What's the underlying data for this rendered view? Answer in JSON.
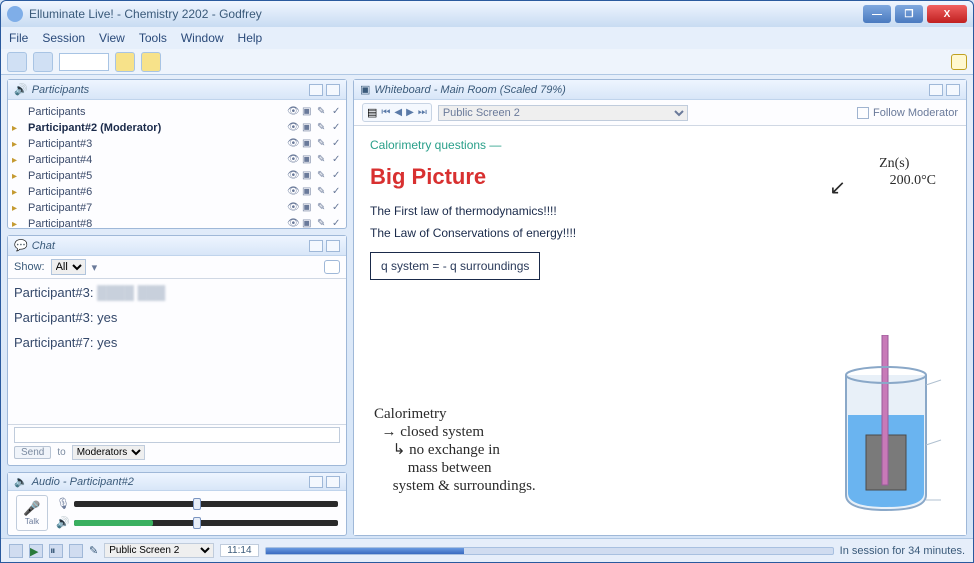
{
  "window": {
    "title": "Elluminate Live! - Chemistry 2202 - Godfrey"
  },
  "menu": {
    "file": "File",
    "session": "Session",
    "view": "View",
    "tools": "Tools",
    "window": "Window",
    "help": "Help"
  },
  "panels": {
    "participants": {
      "title": "Participants"
    },
    "chat": {
      "title": "Chat",
      "show_label": "Show:",
      "show_value": "All",
      "send_label": "Send",
      "to_label": "to",
      "to_value": "Moderators"
    },
    "audio": {
      "title": "Audio - Participant#2",
      "talk": "Talk"
    },
    "whiteboard": {
      "title": "Whiteboard - Main Room (Scaled 79%)",
      "screen_select": "Public Screen 2",
      "follow_label": "Follow Moderator"
    }
  },
  "participants": [
    {
      "name": "Participants",
      "bold": false
    },
    {
      "name": "Participant#2 (Moderator)",
      "bold": true
    },
    {
      "name": "Participant#3",
      "bold": false
    },
    {
      "name": "Participant#4",
      "bold": false
    },
    {
      "name": "Participant#5",
      "bold": false
    },
    {
      "name": "Participant#6",
      "bold": false
    },
    {
      "name": "Participant#7",
      "bold": false
    },
    {
      "name": "Participant#8",
      "bold": false
    }
  ],
  "chat_messages": [
    {
      "who": "Participant#3:",
      "text": "",
      "blur": true
    },
    {
      "who": "Participant#3:",
      "text": "yes",
      "blur": false
    },
    {
      "who": "Participant#7:",
      "text": "yes",
      "blur": false
    }
  ],
  "whiteboard_content": {
    "link": "Calorimetry questions —",
    "heading": "Big Picture",
    "line1": "The First law of thermodynamics!!!!",
    "line2": "The Law of Conservations of energy!!!!",
    "equation": "q system    =  - q   surroundings",
    "hand_top": "Zn(s)\n   200.0°C",
    "hand_arrow": "↙",
    "hand_block": "Calorimetry\n  → closed system\n     ↳ no exchange in\n         mass between\n     system & surroundings."
  },
  "statusbar": {
    "screen": "Public Screen 2",
    "time": "11:14",
    "session_text": "In session for 34 minutes."
  }
}
